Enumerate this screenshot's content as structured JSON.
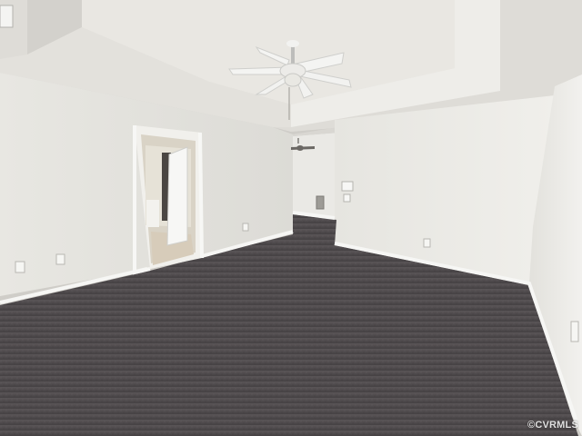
{
  "watermark": {
    "text": "©CVRMLS"
  },
  "scene": {
    "description_icons": [
      "ceiling-fan-icon",
      "outlet-icon",
      "vent-icon",
      "thermostat-icon"
    ],
    "colors": {
      "ceiling": "#e6e4df",
      "tray": "#dcdad4",
      "wall_left": "#e4e3de",
      "wall_right": "#ecebe7",
      "wall_far": "#d9d8d3",
      "carpet": "#4a4648",
      "carpet_light": "#5c5759",
      "trim": "#f4f4f2",
      "tile": "#d8cfc0"
    }
  }
}
